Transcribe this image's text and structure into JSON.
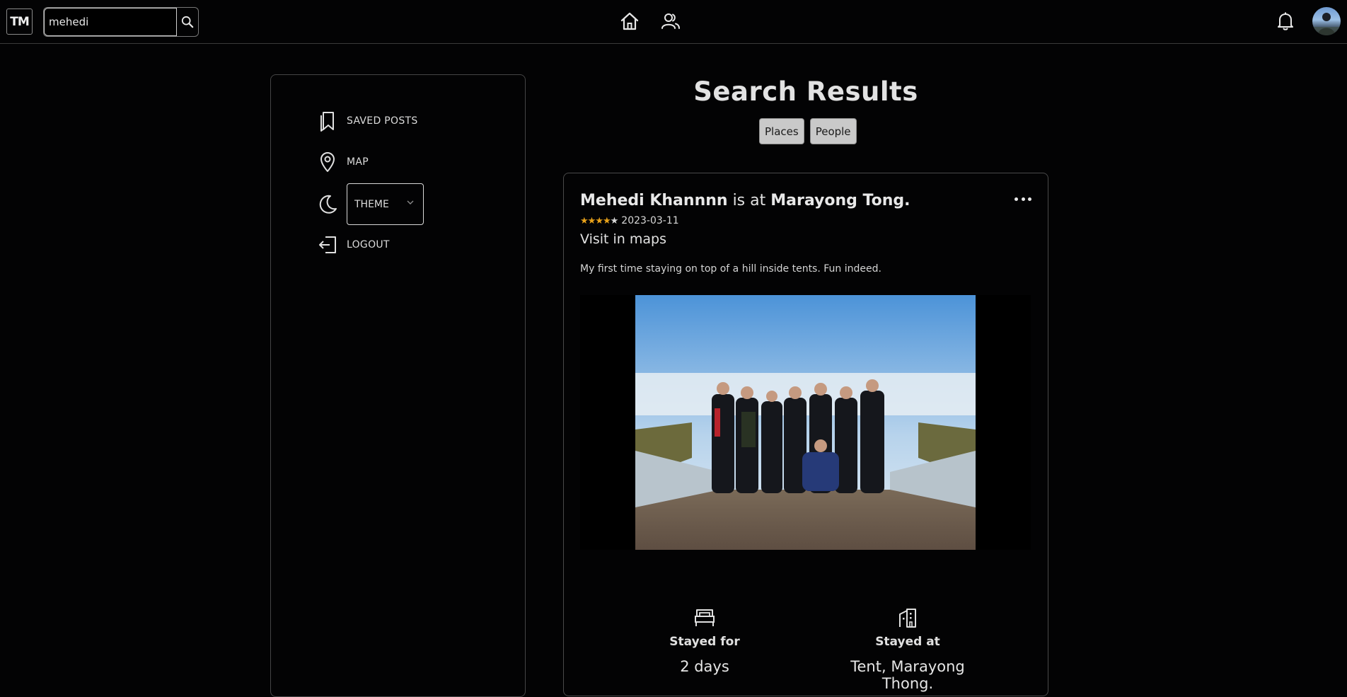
{
  "brand": {
    "logo_text": "TM"
  },
  "search": {
    "value": "mehedi"
  },
  "sidebar": {
    "items": [
      {
        "label": "SAVED POSTS",
        "icon": "bookmark-icon"
      },
      {
        "label": "MAP",
        "icon": "location-pin-icon"
      },
      {
        "label": "THEME",
        "icon": "moon-icon"
      },
      {
        "label": "LOGOUT",
        "icon": "logout-icon"
      }
    ]
  },
  "main": {
    "title": "Search Results",
    "filters": [
      "Places",
      "People"
    ]
  },
  "post": {
    "author": "Mehedi Khannnn",
    "connector": "is at",
    "place": "Marayong Tong.",
    "rating": 4,
    "rating_max": 5,
    "date": "2023-03-11",
    "maps_link": "Visit in maps",
    "text": "My first time staying on top of a hill inside tents. Fun indeed.",
    "stats": [
      {
        "label": "Stayed for",
        "value": "2 days",
        "icon": "bed-icon"
      },
      {
        "label": "Stayed at",
        "value": "Tent, Marayong Thong.",
        "icon": "building-icon"
      }
    ]
  },
  "colors": {
    "background": "#030304",
    "text": "#e6e6e6",
    "star": "#e8a21a",
    "filter_bg": "#c9c9c9"
  }
}
